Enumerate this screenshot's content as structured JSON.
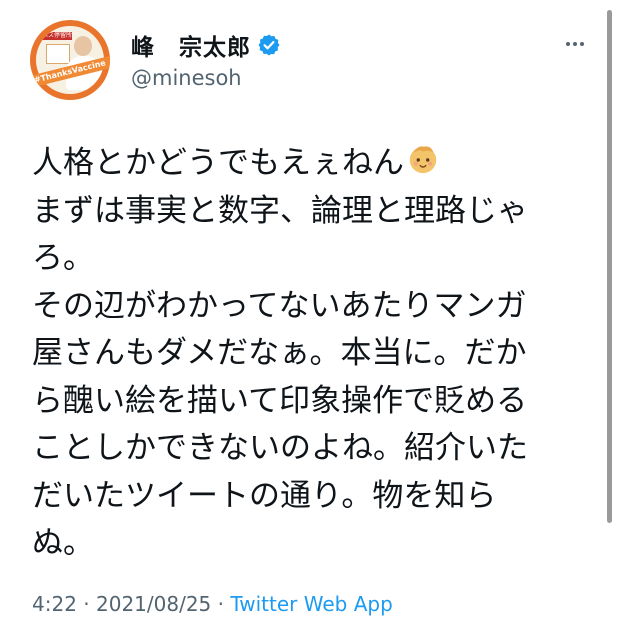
{
  "author": {
    "display_name": "峰　宗太郎",
    "handle": "@minesoh",
    "avatar": {
      "sign_text": "バス停留所",
      "ribbon_text": "#ThanksVaccine"
    }
  },
  "tweet": {
    "lines": [
      "人格とかどうでもえぇねん",
      "まずは事実と数字、論理と理路じゃ",
      "ろ。",
      "その辺がわかってないあたりマンガ",
      "屋さんもダメだなぁ。本当に。だか",
      "ら醜い絵を描いて印象操作で貶める",
      "ことしかできないのよね。紹介いた",
      "だいたツイートの通り。物を知ら",
      "ぬ。"
    ],
    "emoji": "baby-face-emoji",
    "time": "4:22",
    "separator1": " · ",
    "date": "2021/08/25",
    "separator2": " · ",
    "source": "Twitter Web App"
  },
  "colors": {
    "text": "#0f1419",
    "secondary": "#536471",
    "link": "#1d9bf0",
    "verified": "#1d9bf0"
  }
}
